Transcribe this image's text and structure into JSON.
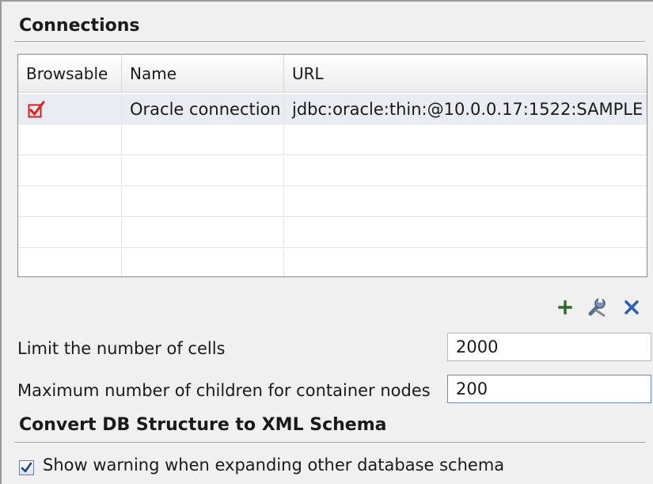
{
  "connections": {
    "title": "Connections",
    "columns": [
      "Browsable",
      "Name",
      "URL"
    ],
    "rows": [
      {
        "browsable": true,
        "name": "Oracle connection",
        "url": "jdbc:oracle:thin:@10.0.0.17:1522:SAMPLE"
      }
    ],
    "toolbar": {
      "add_icon": "plus-icon",
      "edit_icon": "wrench-icon",
      "delete_icon": "close-icon"
    }
  },
  "limits": {
    "cells_label": "Limit the number of cells",
    "cells_value": "2000",
    "children_label": "Maximum number of children for container nodes",
    "children_value": "200"
  },
  "convert": {
    "title": "Convert DB Structure to XML Schema",
    "warning_label": "Show warning when expanding other database schema",
    "warning_checked": true
  },
  "colors": {
    "check_red": "#e0201a",
    "selected_row": "#e9ecf2",
    "delete_blue": "#2b5fb3",
    "add_green": "#2f6b2f"
  }
}
